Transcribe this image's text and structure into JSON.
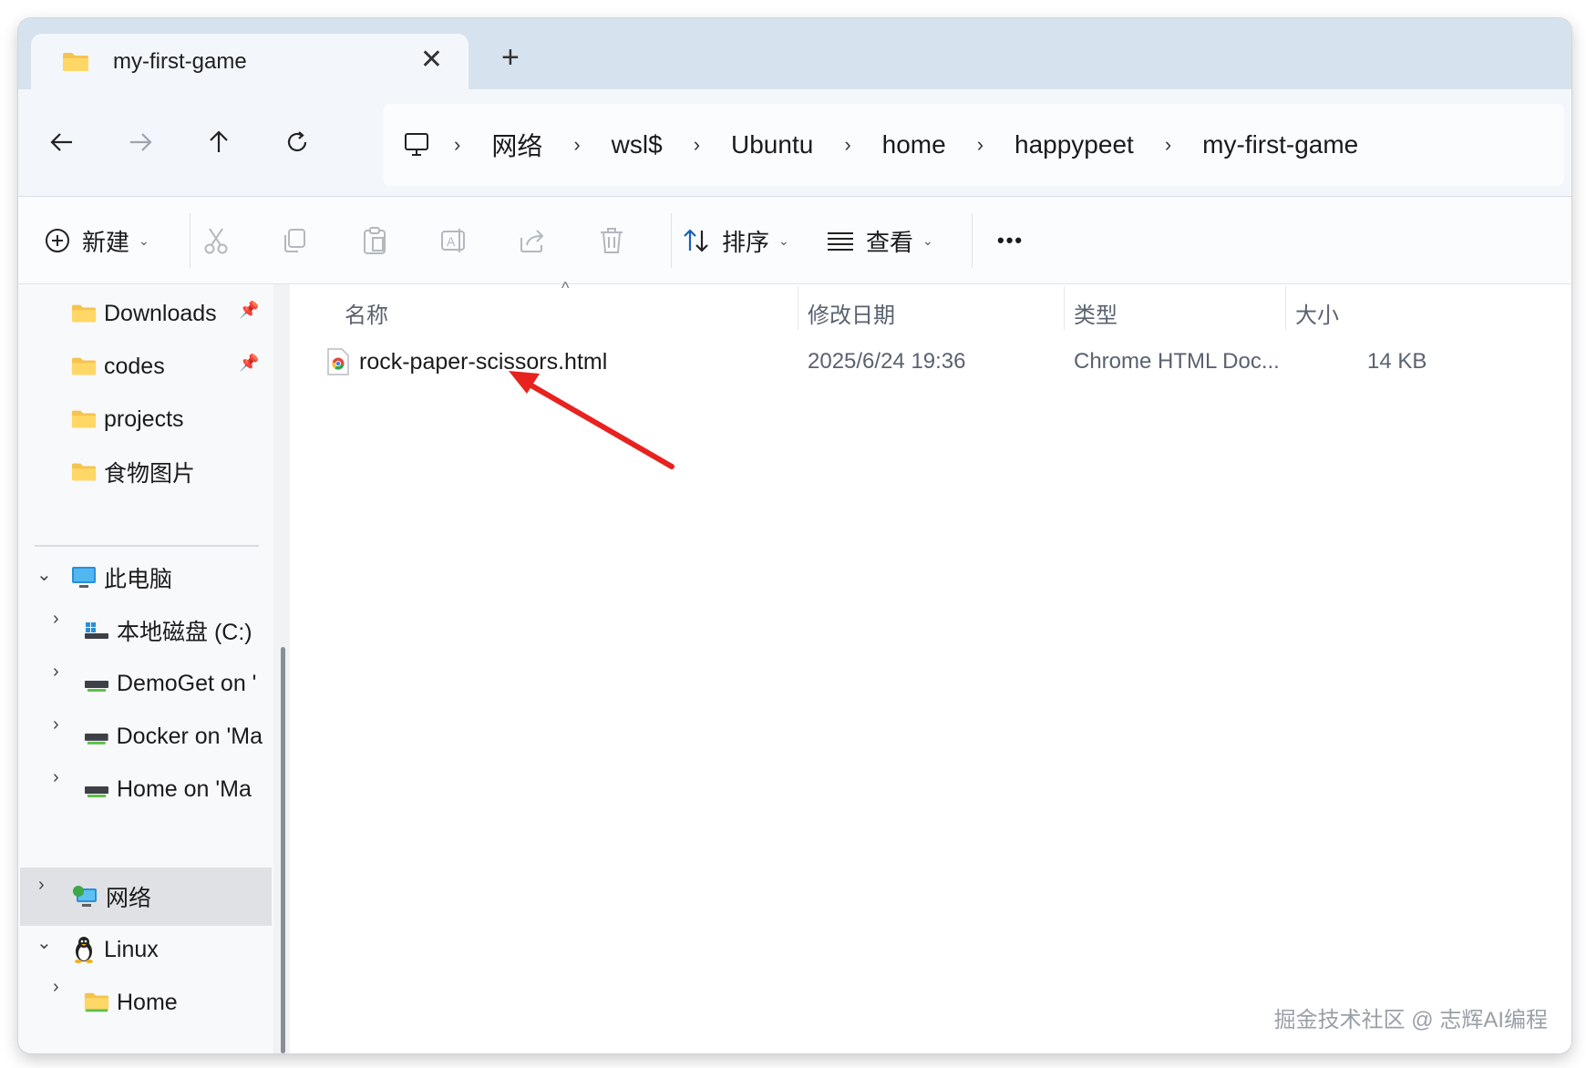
{
  "tab": {
    "title": "my-first-game",
    "close": "✕",
    "new_tab": "+"
  },
  "nav": {
    "back": "back-arrow-icon",
    "forward": "forward-arrow-icon",
    "up": "up-arrow-icon",
    "refresh": "refresh-icon"
  },
  "breadcrumb": [
    "网络",
    "wsl$",
    "Ubuntu",
    "home",
    "happypeet",
    "my-first-game"
  ],
  "toolbar": {
    "new_label": "新建",
    "sort_label": "排序",
    "view_label": "查看",
    "more_label": "•••"
  },
  "sidebar": {
    "quick": [
      {
        "label": "Downloads",
        "pinned": true
      },
      {
        "label": "codes",
        "pinned": true
      },
      {
        "label": "projects",
        "pinned": false
      },
      {
        "label": "食物图片",
        "pinned": false
      }
    ],
    "this_pc": "此电脑",
    "drives": [
      {
        "label": "本地磁盘 (C:)"
      },
      {
        "label": "DemoGet on '"
      },
      {
        "label": "Docker on 'Ma"
      },
      {
        "label": "Home on 'Ma"
      }
    ],
    "network": "网络",
    "linux": "Linux",
    "linux_home": "Home"
  },
  "columns": {
    "name": "名称",
    "modified": "修改日期",
    "type": "类型",
    "size": "大小"
  },
  "files": [
    {
      "name": "rock-paper-scissors.html",
      "modified": "2025/6/24 19:36",
      "type": "Chrome HTML Doc...",
      "size": "14 KB"
    }
  ],
  "colors": {
    "folder": "#f5c44f",
    "annotation_arrow": "#e8221f",
    "selected": "#dfe1e4"
  },
  "watermark": "掘金技术社区 @ 志辉AI编程"
}
